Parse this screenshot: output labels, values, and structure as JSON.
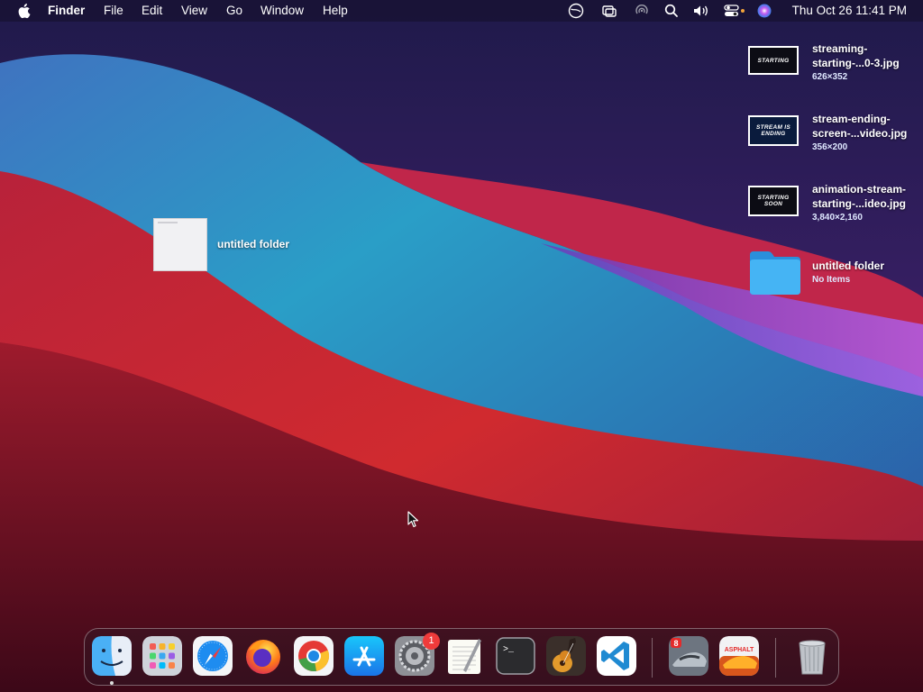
{
  "menubar": {
    "app_name": "Finder",
    "menus": [
      "File",
      "Edit",
      "View",
      "Go",
      "Window",
      "Help"
    ],
    "clock": "Thu Oct 26  11:41 PM"
  },
  "desktop": {
    "left_folder": {
      "name": "untitled folder"
    },
    "files": [
      {
        "name_line1": "streaming-",
        "name_line2": "starting-...0-3.jpg",
        "meta": "626×352",
        "thumb_text": "STARTING"
      },
      {
        "name_line1": "stream-ending-",
        "name_line2": "screen-...video.jpg",
        "meta": "356×200",
        "thumb_text": "STREAM IS ENDING"
      },
      {
        "name_line1": "animation-stream-",
        "name_line2": "starting-...ideo.jpg",
        "meta": "3,840×2,160",
        "thumb_text": "STARTING SOON"
      },
      {
        "name_line1": "untitled folder",
        "name_line2": "",
        "meta": "No Items",
        "thumb_text": ""
      }
    ]
  },
  "dock": {
    "apps": [
      "Finder",
      "Launchpad",
      "Safari",
      "Firefox",
      "Google Chrome",
      "App Store",
      "System Preferences",
      "TextEdit",
      "Terminal",
      "GarageBand",
      "Visual Studio Code",
      "Asphalt 8",
      "Asphalt",
      "Trash"
    ],
    "system_preferences_badge": "1",
    "asphalt8_label": "8",
    "asphalt_label": "ASPHALT",
    "terminal_prompt": ">_"
  },
  "colors": {
    "folder_blue": "#3aa8f0",
    "badge_red": "#ef3b3b"
  }
}
